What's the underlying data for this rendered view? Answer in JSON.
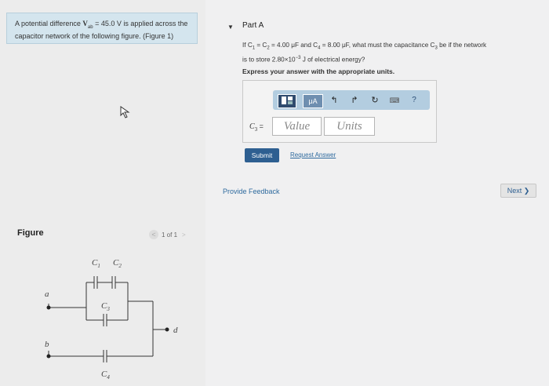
{
  "problem": {
    "text_prefix": "A potential difference ",
    "vab": "V",
    "vab_sub": "ab",
    "vab_value": " = 45.0 V",
    "text_suffix": " is applied across the",
    "line2": "capacitor network of the following figure. (Figure 1)"
  },
  "figure": {
    "label": "Figure",
    "pager_prev": "<",
    "pager_text": "1 of 1",
    "pager_next": ">",
    "labels": {
      "c1": "C",
      "c1_sub": "1",
      "c2": "C",
      "c2_sub": "2",
      "c3": "C",
      "c3_sub": "3",
      "c4": "C",
      "c4_sub": "4",
      "a": "a",
      "b": "b",
      "d": "d"
    }
  },
  "part": {
    "arrow": "▼",
    "title": "Part A",
    "question_line1_a": "If C",
    "question_line1_b": "1",
    "question_line1_c": " = C",
    "question_line1_d": "2",
    "question_line1_e": " = 4.00 μF and C",
    "question_line1_f": "4",
    "question_line1_g": " = 8.00 μF, what must the capacitance C",
    "question_line1_h": "3",
    "question_line1_i": " be if the network",
    "question_line2_a": "is to store 2.80×10",
    "question_line2_exp": "−3",
    "question_line2_b": " J of electrical energy?",
    "express": "Express your answer with the appropriate units."
  },
  "answer": {
    "toolbar": {
      "mu": "μA",
      "undo": "↰",
      "redo": "↱",
      "reset": "↻",
      "keyboard": "⌨",
      "help": "?"
    },
    "var_label": "C",
    "var_sub": "3",
    "var_eq": " =",
    "value_placeholder": "Value",
    "units_placeholder": "Units"
  },
  "actions": {
    "submit": "Submit",
    "request_answer": "Request Answer",
    "feedback": "Provide Feedback",
    "next": "Next ❯"
  }
}
